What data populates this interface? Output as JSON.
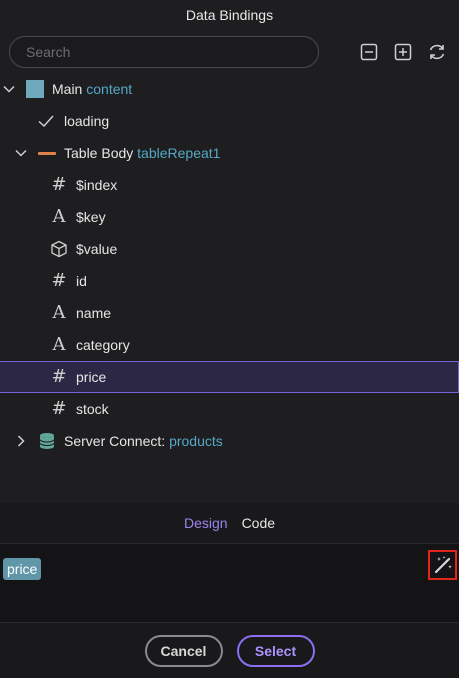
{
  "window": {
    "title": "Data Bindings"
  },
  "search": {
    "placeholder": "Search"
  },
  "toolbar": {
    "collapse_icon": "minus-square-icon",
    "expand_icon": "plus-square-icon",
    "refresh_icon": "refresh-icon"
  },
  "tree": {
    "main": {
      "label": "Main",
      "accent": "content"
    },
    "loading": {
      "label": "loading"
    },
    "table_body": {
      "label": "Table Body",
      "accent": "tableRepeat1"
    },
    "items": [
      {
        "label": "$index",
        "icon": "hash-icon"
      },
      {
        "label": "$key",
        "icon": "text-type-icon"
      },
      {
        "label": "$value",
        "icon": "cube-icon"
      },
      {
        "label": "id",
        "icon": "hash-icon"
      },
      {
        "label": "name",
        "icon": "text-type-icon"
      },
      {
        "label": "category",
        "icon": "text-type-icon"
      },
      {
        "label": "price",
        "icon": "hash-icon",
        "selected": true
      },
      {
        "label": "stock",
        "icon": "hash-icon"
      }
    ],
    "server_connect": {
      "label": "Server Connect:",
      "accent": "products"
    }
  },
  "tabs": {
    "design": "Design",
    "code": "Code"
  },
  "editor": {
    "expression": "price"
  },
  "footer": {
    "cancel": "Cancel",
    "select": "Select"
  },
  "colors": {
    "accent_purple": "#9a84f0",
    "accent_teal": "#56a8c6",
    "highlight_red": "#e0261b",
    "background": "#1e1e20"
  }
}
